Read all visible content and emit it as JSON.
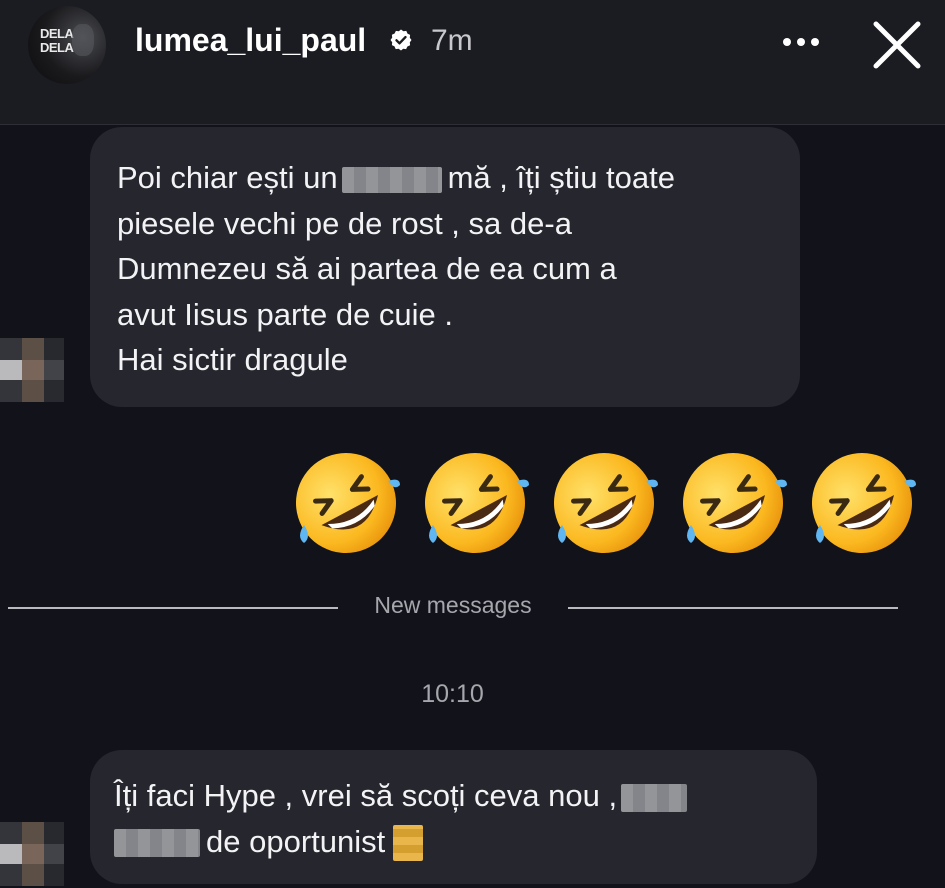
{
  "header": {
    "username": "lumea_lui_paul",
    "time_ago": "7m",
    "avatar_logo_lines": [
      "DELA",
      "DELA"
    ],
    "icons": [
      "verified-badge-icon",
      "more-options-icon",
      "close-icon"
    ]
  },
  "messages": [
    {
      "lines": {
        "l1_a": "Poi chiar ești un",
        "l1_b": "mă , îți știu toate",
        "l2": "piesele vechi pe de rost , sa de-a",
        "l3": "Dumnezeu să ai partea de ea cum a",
        "l4": "avut Iisus parte de cuie .",
        "l5": "Hai sictir dragule"
      }
    },
    {
      "lines": {
        "l1": "Îți faci Hype , vrei să scoți ceva nou ,",
        "l2": "de oportunist"
      }
    }
  ],
  "emoji_message": {
    "emoji_name": "rolling-on-the-floor-laughing",
    "count": 5
  },
  "divider": {
    "label": "New messages"
  },
  "timestamp": "10:10",
  "colors": {
    "background": "#12131a",
    "header": "#1b1c22",
    "bubble": "#25262e",
    "muted_text": "#a6a7ad"
  }
}
